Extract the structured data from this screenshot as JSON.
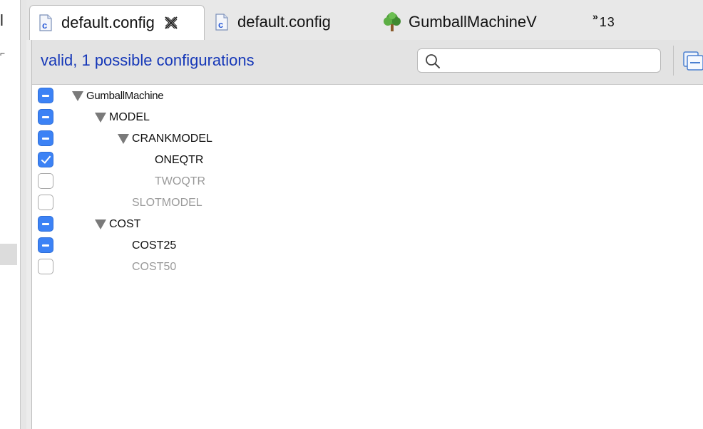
{
  "left_panel": {
    "fragment_top": "l",
    "fragment_arrow": "⌐"
  },
  "tabs": [
    {
      "label": "default.config",
      "icon": "config-file-icon",
      "active": true,
      "close": "⨯"
    },
    {
      "label": "default.config",
      "icon": "config-file-icon",
      "active": false
    },
    {
      "label": "GumballMachineV",
      "icon": "tree-icon",
      "active": false
    }
  ],
  "more_tabs": {
    "chevron": "»",
    "count": "13"
  },
  "header": {
    "status": "valid, 1 possible configurations",
    "search_value": "",
    "search_placeholder": ""
  },
  "tree": [
    {
      "label": "GumballMachine",
      "state": "partial",
      "expanded": true,
      "enabled": true
    },
    {
      "label": "MODEL",
      "state": "partial",
      "expanded": true,
      "enabled": true
    },
    {
      "label": "CRANKMODEL",
      "state": "partial",
      "expanded": true,
      "enabled": true
    },
    {
      "label": "ONEQTR",
      "state": "selected",
      "enabled": true
    },
    {
      "label": "TWOQTR",
      "state": "unselected",
      "enabled": false
    },
    {
      "label": "SLOTMODEL",
      "state": "unselected",
      "enabled": false
    },
    {
      "label": "COST",
      "state": "partial",
      "expanded": true,
      "enabled": true
    },
    {
      "label": "COST25",
      "state": "partial",
      "enabled": true
    },
    {
      "label": "COST50",
      "state": "unselected",
      "enabled": false
    }
  ],
  "colors": {
    "accent": "#3c82f5",
    "status_text": "#1638b8",
    "disabled_text": "#9a9a9a"
  }
}
